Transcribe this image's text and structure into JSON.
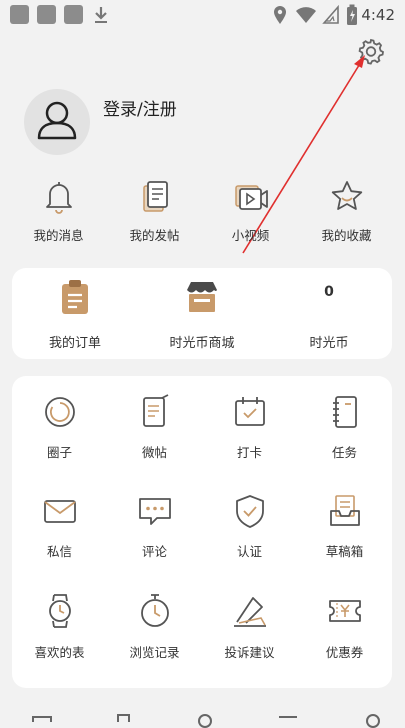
{
  "status_bar": {
    "time": "4:42"
  },
  "profile": {
    "login_label": "登录/注册"
  },
  "quick_actions": [
    {
      "label": "我的消息",
      "icon": "bell-icon"
    },
    {
      "label": "我的发帖",
      "icon": "post-icon"
    },
    {
      "label": "小视频",
      "icon": "video-icon"
    },
    {
      "label": "我的收藏",
      "icon": "star-icon"
    }
  ],
  "wallet": {
    "orders_label": "我的订单",
    "mall_label": "时光币商城",
    "coin_value": "0",
    "coin_label": "时光币"
  },
  "grid": [
    {
      "label": "圈子",
      "icon": "circle-icon"
    },
    {
      "label": "微帖",
      "icon": "note-icon"
    },
    {
      "label": "打卡",
      "icon": "calendar-check-icon"
    },
    {
      "label": "任务",
      "icon": "notebook-icon"
    },
    {
      "label": "私信",
      "icon": "envelope-icon"
    },
    {
      "label": "评论",
      "icon": "comment-icon"
    },
    {
      "label": "认证",
      "icon": "shield-check-icon"
    },
    {
      "label": "草稿箱",
      "icon": "draft-box-icon"
    },
    {
      "label": "喜欢的表",
      "icon": "watch-icon"
    },
    {
      "label": "浏览记录",
      "icon": "history-icon"
    },
    {
      "label": "投诉建议",
      "icon": "feedback-icon"
    },
    {
      "label": "优惠券",
      "icon": "coupon-icon"
    }
  ],
  "colors": {
    "accent": "#c89a6a",
    "stroke": "#555555",
    "annotation_arrow": "#e0302f"
  }
}
